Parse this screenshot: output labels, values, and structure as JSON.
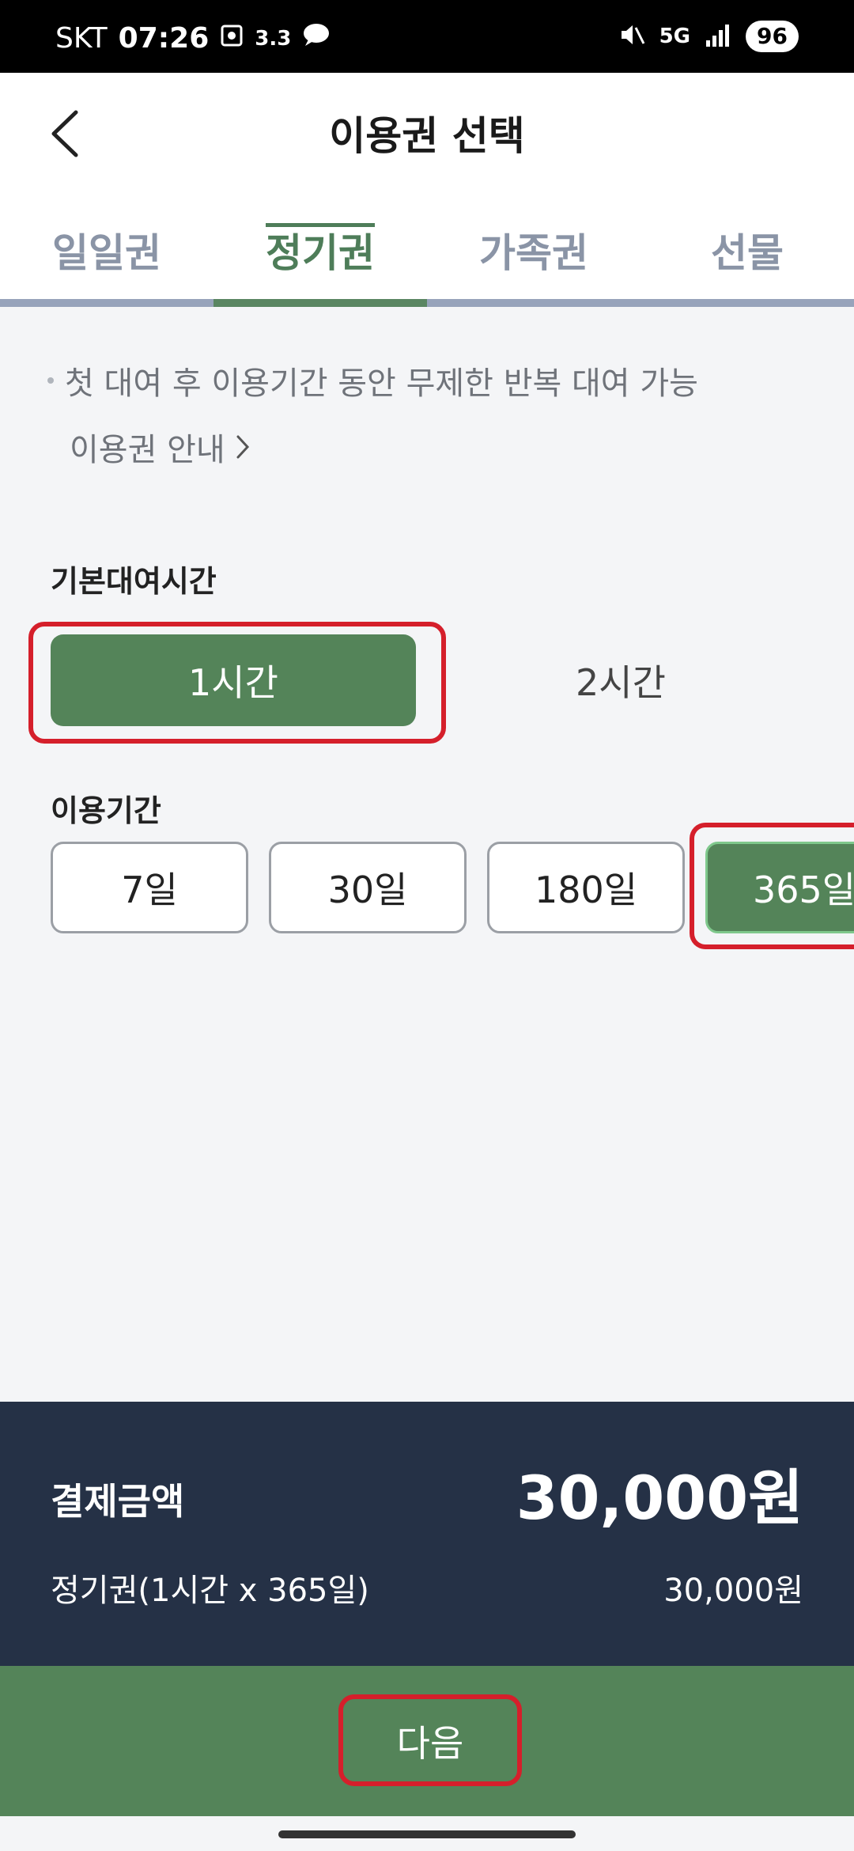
{
  "status_bar": {
    "carrier": "SKT",
    "time": "07:26",
    "speed": "3.3",
    "network": "5G",
    "battery": "96"
  },
  "header": {
    "title": "이용권 선택"
  },
  "tabs": [
    {
      "label": "일일권",
      "active": false
    },
    {
      "label": "정기권",
      "active": true
    },
    {
      "label": "가족권",
      "active": false
    },
    {
      "label": "선물",
      "active": false
    }
  ],
  "info": {
    "note": "첫 대여 후 이용기간 동안 무제한 반복 대여 가능",
    "link": "이용권 안내"
  },
  "rental_time": {
    "title": "기본대여시간",
    "options": [
      "1시간",
      "2시간"
    ],
    "selected": "1시간"
  },
  "period": {
    "title": "이용기간",
    "options": [
      "7일",
      "30일",
      "180일",
      "365일"
    ],
    "selected": "365일"
  },
  "summary": {
    "label": "결제금액",
    "total": "30,000원",
    "detail": "정기권(1시간 x 365일)",
    "detail_price": "30,000원"
  },
  "next_button": "다음",
  "colors": {
    "accent": "#548459",
    "summary_bg": "#253146",
    "highlight": "#d51f2b"
  }
}
